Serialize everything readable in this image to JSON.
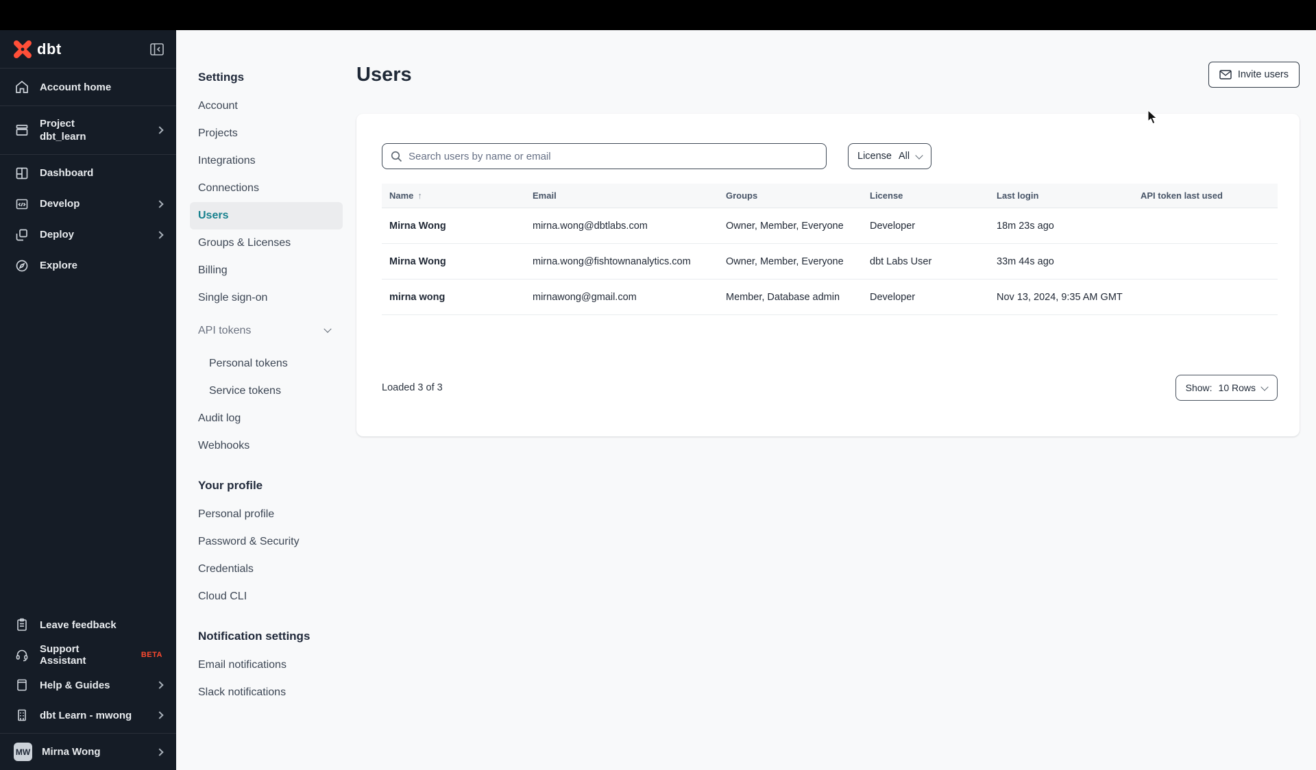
{
  "colors": {
    "brand_orange": "#ff4f38",
    "active_teal": "#15808d",
    "sidebar_bg": "#151c26",
    "beta_badge": "#ff4a2f"
  },
  "sidebar": {
    "logo_text": "dbt",
    "items": [
      {
        "label": "Account home",
        "icon": "home-icon"
      },
      {
        "label": "Project",
        "sublabel": "dbt_learn",
        "icon": "archive-icon"
      },
      {
        "label": "Dashboard",
        "icon": "dashboard-icon"
      },
      {
        "label": "Develop",
        "icon": "code-icon"
      },
      {
        "label": "Deploy",
        "icon": "deploy-icon"
      },
      {
        "label": "Explore",
        "icon": "explore-icon"
      }
    ],
    "bottom_items": [
      {
        "label": "Leave feedback",
        "icon": "clipboard-icon"
      },
      {
        "label": "Support Assistant",
        "badge": "BETA",
        "icon": "headset-icon"
      },
      {
        "label": "Help & Guides",
        "icon": "book-icon"
      },
      {
        "label": "dbt Learn - mwong",
        "icon": "building-icon"
      }
    ],
    "user": {
      "initials": "MW",
      "name": "Mirna Wong"
    }
  },
  "settings_nav": {
    "heading1": "Settings",
    "items1": [
      {
        "label": "Account"
      },
      {
        "label": "Projects"
      },
      {
        "label": "Integrations"
      },
      {
        "label": "Connections"
      },
      {
        "label": "Users"
      },
      {
        "label": "Groups & Licenses"
      },
      {
        "label": "Billing"
      },
      {
        "label": "Single sign-on"
      },
      {
        "label": "API tokens"
      },
      {
        "label": "Personal tokens"
      },
      {
        "label": "Service tokens"
      },
      {
        "label": "Audit log"
      },
      {
        "label": "Webhooks"
      }
    ],
    "heading2": "Your profile",
    "items2": [
      {
        "label": "Personal profile"
      },
      {
        "label": "Password & Security"
      },
      {
        "label": "Credentials"
      },
      {
        "label": "Cloud CLI"
      }
    ],
    "heading3": "Notification settings",
    "items3": [
      {
        "label": "Email notifications"
      },
      {
        "label": "Slack notifications"
      }
    ]
  },
  "main": {
    "title": "Users",
    "invite_button_label": "Invite users",
    "search": {
      "placeholder": "Search users by name or email"
    },
    "license_filter": {
      "label": "License",
      "value": "All"
    },
    "table": {
      "columns": {
        "name": "Name",
        "email": "Email",
        "groups": "Groups",
        "license": "License",
        "last_login": "Last login",
        "api_token": "API token last used"
      },
      "sort_arrow": "↑",
      "rows": [
        {
          "name": "Mirna Wong",
          "email": "mirna.wong@dbtlabs.com",
          "groups": "Owner, Member, Everyone",
          "license": "Developer",
          "last_login": "18m 23s ago",
          "api_token": ""
        },
        {
          "name": "Mirna Wong",
          "email": "mirna.wong@fishtownanalytics.com",
          "groups": "Owner, Member, Everyone",
          "license": "dbt Labs User",
          "last_login": "33m 44s ago",
          "api_token": ""
        },
        {
          "name": "mirna wong",
          "email": "mirnawong@gmail.com",
          "groups": "Member, Database admin",
          "license": "Developer",
          "last_login": "Nov 13, 2024, 9:35 AM GMT",
          "api_token": ""
        }
      ]
    },
    "footer": {
      "loaded_text": "Loaded 3 of 3",
      "show_label": "Show:",
      "show_value": "10 Rows"
    }
  }
}
